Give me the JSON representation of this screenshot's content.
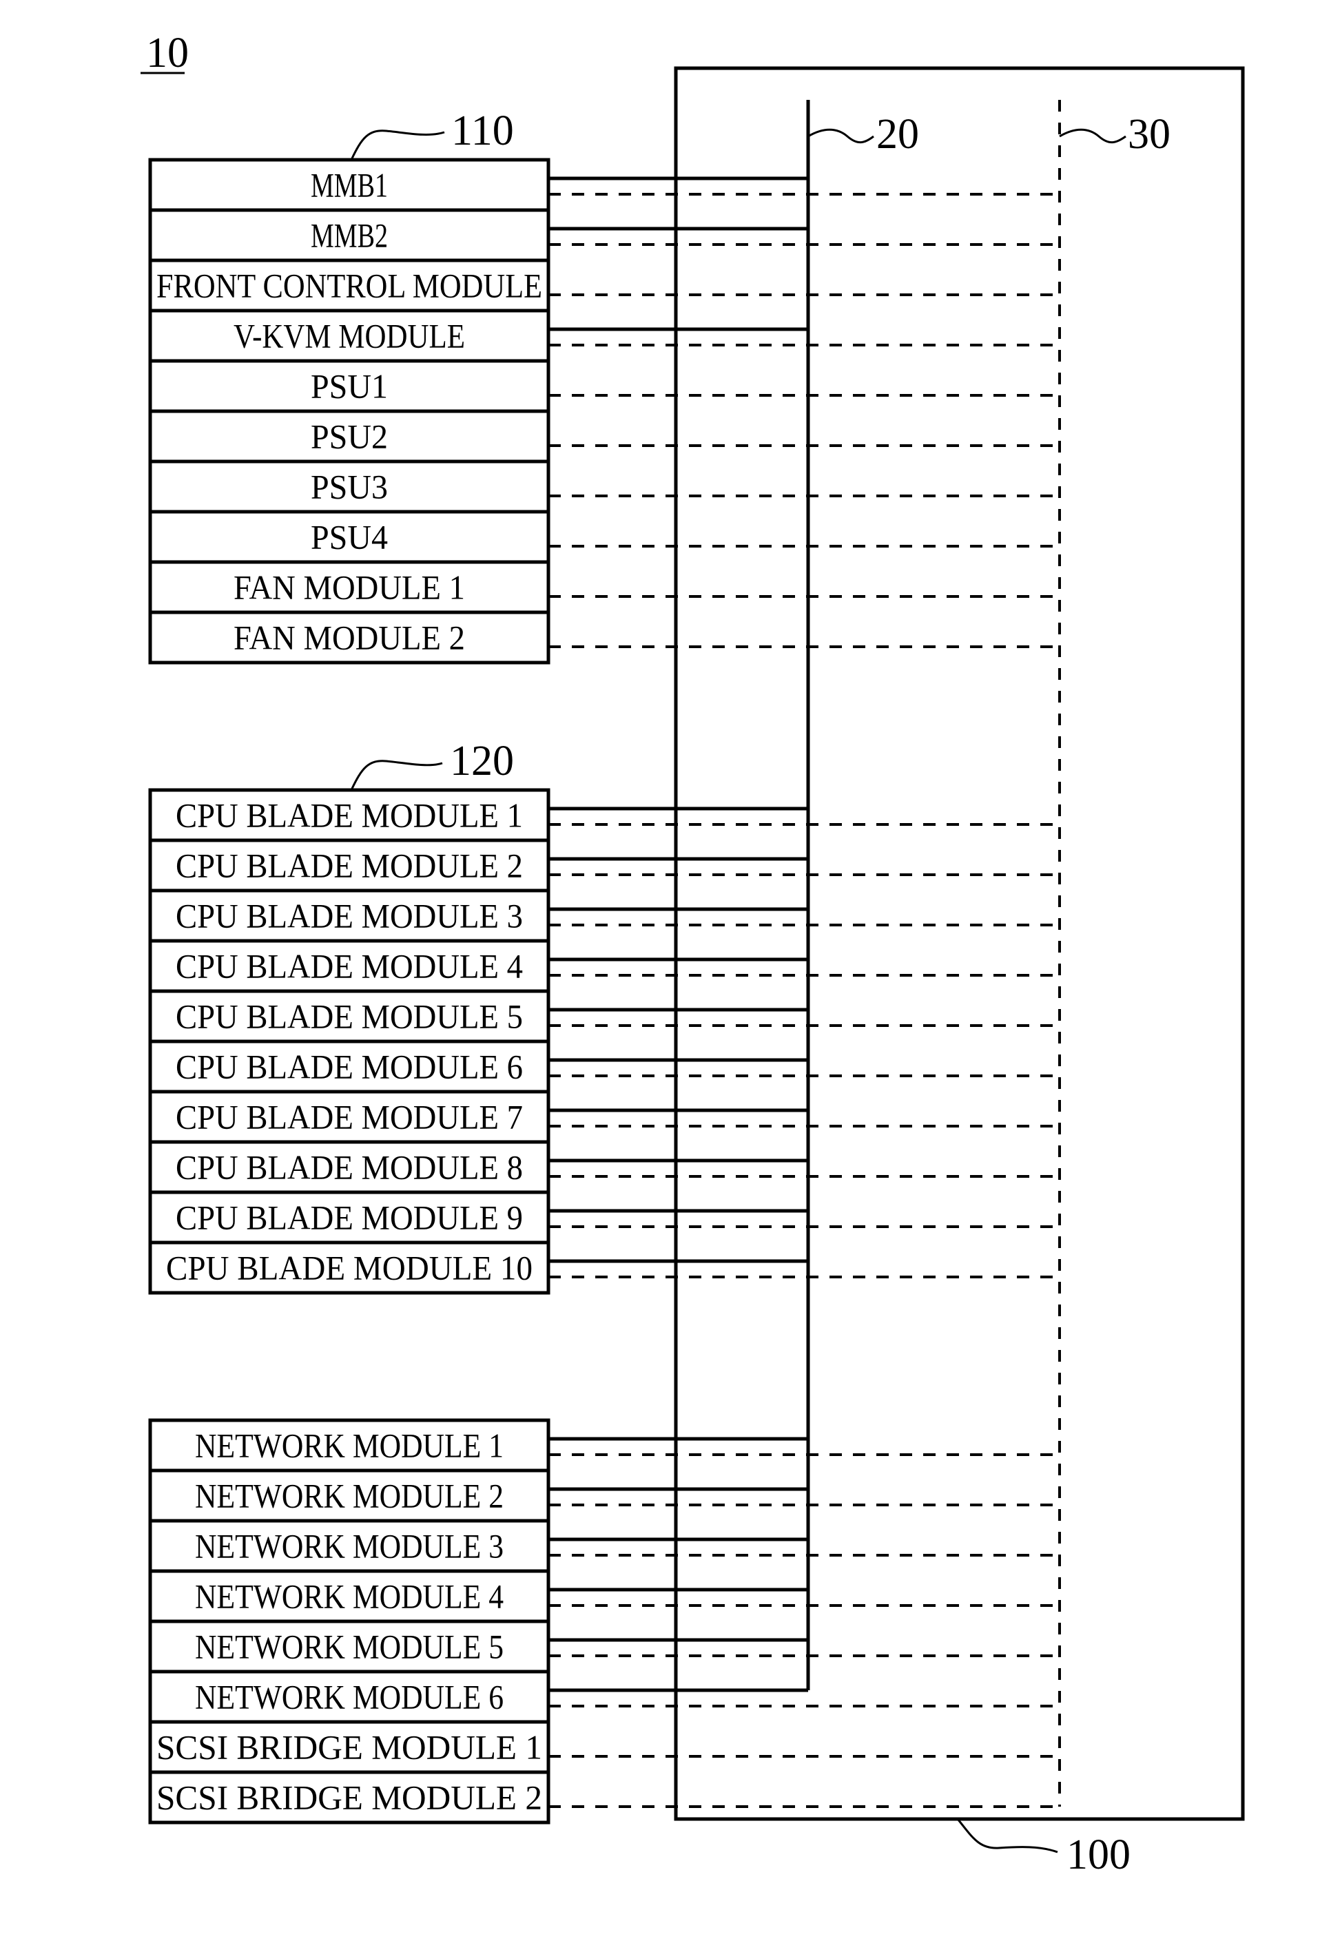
{
  "figure": {
    "ref_label": "10",
    "description": "Block diagram of a blade server system: module groups connected to a backplane via a solid bus and a dashed bus"
  },
  "backplane": {
    "ref_label": "100",
    "bus_solid": {
      "ref_label": "20",
      "style": "solid"
    },
    "bus_dashed": {
      "ref_label": "30",
      "style": "dashed"
    }
  },
  "groups": [
    {
      "id": "group-110",
      "ref_label": "110",
      "modules": [
        {
          "label": "MMB1",
          "solid_link": true,
          "dashed_link": true
        },
        {
          "label": "MMB2",
          "solid_link": true,
          "dashed_link": true
        },
        {
          "label": "FRONT CONTROL MODULE",
          "solid_link": false,
          "dashed_link": true
        },
        {
          "label": "V-KVM MODULE",
          "solid_link": true,
          "dashed_link": true
        },
        {
          "label": "PSU1",
          "solid_link": false,
          "dashed_link": true
        },
        {
          "label": "PSU2",
          "solid_link": false,
          "dashed_link": true
        },
        {
          "label": "PSU3",
          "solid_link": false,
          "dashed_link": true
        },
        {
          "label": "PSU4",
          "solid_link": false,
          "dashed_link": true
        },
        {
          "label": "FAN MODULE 1",
          "solid_link": false,
          "dashed_link": true
        },
        {
          "label": "FAN MODULE 2",
          "solid_link": false,
          "dashed_link": true
        }
      ]
    },
    {
      "id": "group-120",
      "ref_label": "120",
      "modules": [
        {
          "label": "CPU BLADE MODULE 1",
          "solid_link": true,
          "dashed_link": true
        },
        {
          "label": "CPU BLADE MODULE 2",
          "solid_link": true,
          "dashed_link": true
        },
        {
          "label": "CPU BLADE MODULE 3",
          "solid_link": true,
          "dashed_link": true
        },
        {
          "label": "CPU BLADE MODULE 4",
          "solid_link": true,
          "dashed_link": true
        },
        {
          "label": "CPU BLADE MODULE 5",
          "solid_link": true,
          "dashed_link": true
        },
        {
          "label": "CPU BLADE MODULE 6",
          "solid_link": true,
          "dashed_link": true
        },
        {
          "label": "CPU BLADE MODULE 7",
          "solid_link": true,
          "dashed_link": true
        },
        {
          "label": "CPU BLADE MODULE 8",
          "solid_link": true,
          "dashed_link": true
        },
        {
          "label": "CPU BLADE MODULE 9",
          "solid_link": true,
          "dashed_link": true
        },
        {
          "label": "CPU BLADE MODULE 10",
          "solid_link": true,
          "dashed_link": true
        }
      ]
    },
    {
      "id": "group-io",
      "ref_label": "",
      "modules": [
        {
          "label": "NETWORK MODULE 1",
          "solid_link": true,
          "dashed_link": true
        },
        {
          "label": "NETWORK MODULE 2",
          "solid_link": true,
          "dashed_link": true
        },
        {
          "label": "NETWORK MODULE 3",
          "solid_link": true,
          "dashed_link": true
        },
        {
          "label": "NETWORK MODULE 4",
          "solid_link": true,
          "dashed_link": true
        },
        {
          "label": "NETWORK MODULE 5",
          "solid_link": true,
          "dashed_link": true
        },
        {
          "label": "NETWORK MODULE 6",
          "solid_link": true,
          "dashed_link": true
        },
        {
          "label": "SCSI BRIDGE MODULE 1",
          "solid_link": false,
          "dashed_link": true
        },
        {
          "label": "SCSI BRIDGE MODULE 2",
          "solid_link": false,
          "dashed_link": true
        }
      ]
    }
  ]
}
